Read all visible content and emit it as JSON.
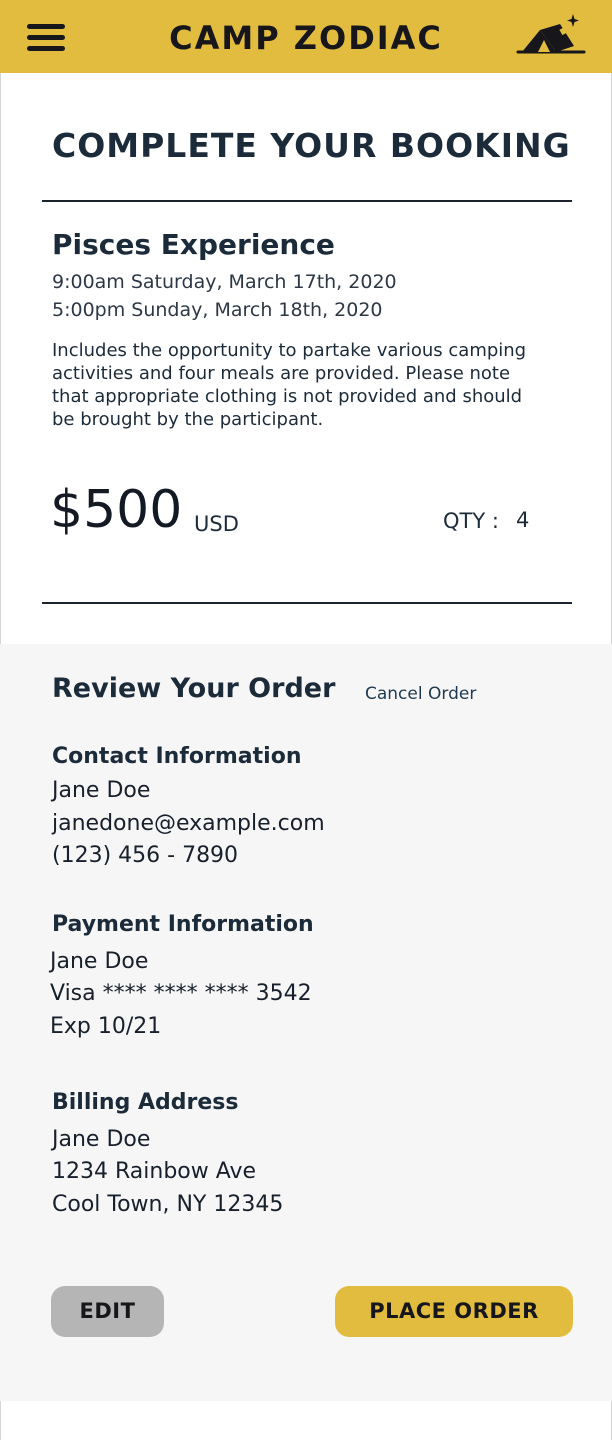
{
  "header": {
    "brand": "CAMP ZODIAC",
    "colors": {
      "accent": "#e2bc3f",
      "text": "#17171b"
    },
    "icons": [
      "menu-icon",
      "tent-telescope-logo-icon"
    ]
  },
  "booking": {
    "title": "COMPLETE YOUR BOOKING",
    "event_name": "Pisces Experience",
    "start": "9:00am Saturday, March 17th, 2020",
    "end": "5:00pm Sunday, March 18th, 2020",
    "description": "Includes the opportunity to partake various camping activities and four meals are provided. Please note that appropriate clothing is not provided and should be brought by the participant.",
    "price": "$500",
    "currency": "USD",
    "qty_label": "QTY :",
    "qty_value": "4"
  },
  "review": {
    "title": "Review Your Order",
    "cancel_label": "Cancel Order",
    "contact": {
      "heading": "Contact Information",
      "name": "Jane Doe",
      "email": "janedone@example.com",
      "phone": "(123) 456 - 7890"
    },
    "payment": {
      "heading": "Payment Information",
      "name": "Jane Doe",
      "card": "Visa **** **** **** 3542",
      "exp": "Exp 10/21"
    },
    "billing": {
      "heading": "Billing Address",
      "name": "Jane Doe",
      "street": "1234 Rainbow Ave",
      "city": "Cool Town, NY 12345"
    }
  },
  "actions": {
    "edit_label": "EDIT",
    "place_label": "PLACE ORDER"
  }
}
